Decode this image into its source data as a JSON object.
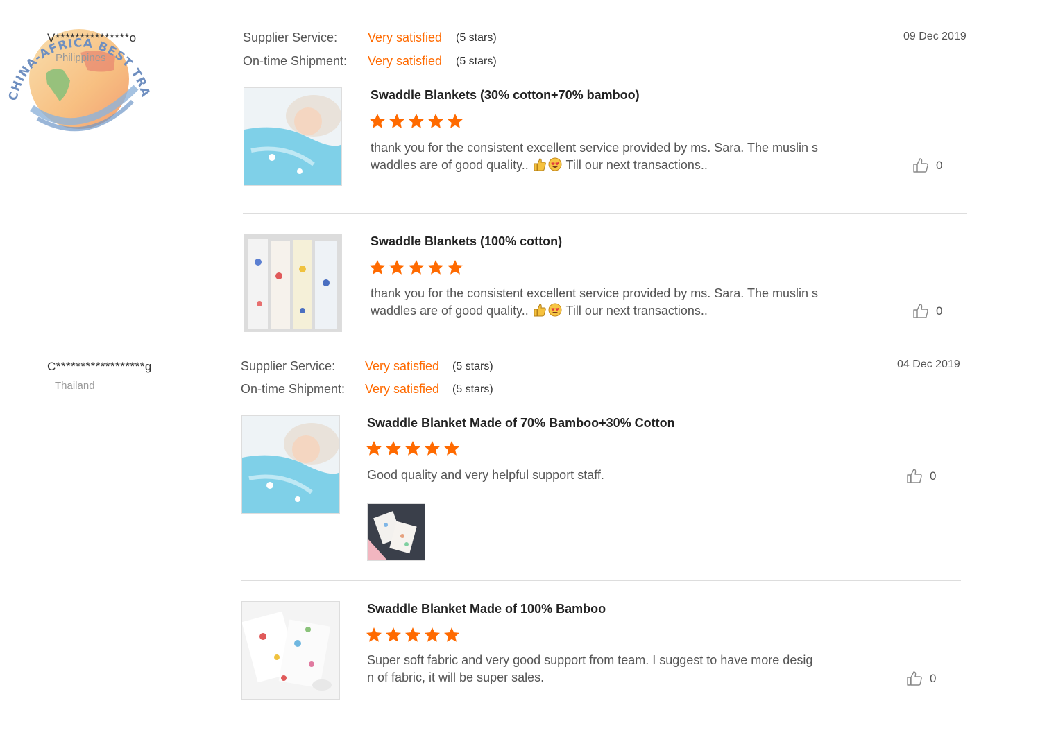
{
  "watermark": {
    "text": "CHINA-AFRICA BEST TRADING PLATFORM"
  },
  "reviews": [
    {
      "buyer": {
        "name": "V***************o",
        "country": "Philippines"
      },
      "date": "09 Dec 2019",
      "supplier_service": {
        "label": "Supplier Service:",
        "value": "Very satisfied",
        "stars": "(5 stars)"
      },
      "shipment": {
        "label": "On-time Shipment:",
        "value": "Very satisfied",
        "stars": "(5 stars)"
      },
      "products": [
        {
          "title": "Swaddle Blankets (30% cotton+70% bamboo)",
          "rating": 5,
          "comment_line1": "thank you for the consistent excellent service provided by ms. Sara. The muslin s",
          "comment_line2_a": "waddles are of good quality..",
          "comment_line2_b": "Till our next transactions..",
          "likes": "0",
          "thumb": "baby-blue-blanket"
        },
        {
          "title": "Swaddle Blankets (100% cotton)",
          "rating": 5,
          "comment_line1": "thank you for the consistent excellent service provided by ms. Sara. The muslin s",
          "comment_line2_a": "waddles are of good quality..",
          "comment_line2_b": "Till our next transactions..",
          "likes": "0",
          "thumb": "hanging-blankets"
        }
      ]
    },
    {
      "buyer": {
        "name": "C******************g",
        "country": "Thailand"
      },
      "date": "04 Dec 2019",
      "supplier_service": {
        "label": "Supplier Service:",
        "value": "Very satisfied",
        "stars": "(5 stars)"
      },
      "shipment": {
        "label": "On-time Shipment:",
        "value": "Very satisfied",
        "stars": "(5 stars)"
      },
      "products": [
        {
          "title": "Swaddle Blanket Made of 70% Bamboo+30% Cotton",
          "rating": 5,
          "comment_line1": "Good quality and very helpful support staff.",
          "likes": "0",
          "thumb": "baby-blue-blanket"
        },
        {
          "title": "Swaddle Blanket Made of 100% Bamboo",
          "rating": 5,
          "comment_line1": "Super soft fabric and very good support from team. I suggest to have more desig",
          "comment_line2_a": "n of fabric, it will be super sales.",
          "likes": "0",
          "thumb": "printed-blankets"
        }
      ]
    }
  ],
  "colors": {
    "accent": "#ff6a00",
    "divider": "#dddddd"
  }
}
